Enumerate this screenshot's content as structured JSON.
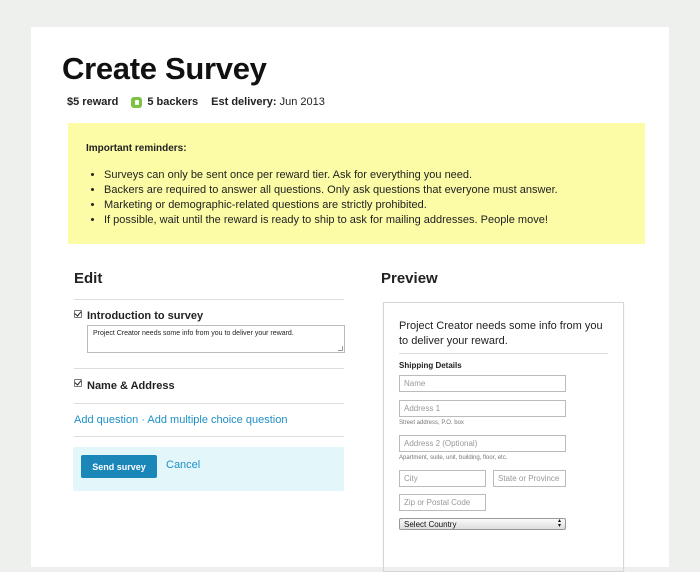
{
  "page": {
    "title": "Create Survey",
    "reward": "$5 reward",
    "backers": "5 backers",
    "delivery_label": "Est delivery:",
    "delivery_value": "Jun 2013"
  },
  "reminders": {
    "heading": "Important reminders:",
    "items": [
      "Surveys can only be sent once per reward tier. Ask for everything you need.",
      "Backers are required to answer all questions. Only ask questions that everyone must answer.",
      "Marketing or demographic-related questions are strictly prohibited.",
      "If possible, wait until the reward is ready to ship to ask for mailing addresses. People move!"
    ]
  },
  "edit": {
    "heading": "Edit",
    "intro_label": "Introduction to survey",
    "intro_text": "Project Creator needs some info from you to deliver your reward.",
    "name_address_label": "Name & Address",
    "add_question": "Add question",
    "separator": "·",
    "add_multiple_choice": "Add multiple choice question",
    "send_label": "Send survey",
    "cancel_label": "Cancel"
  },
  "preview": {
    "heading": "Preview",
    "intro_text": "Project Creator needs some info from you to deliver your reward.",
    "shipping_heading": "Shipping Details",
    "name_placeholder": "Name",
    "address1_placeholder": "Address 1",
    "address1_hint": "Street address, P.O. box",
    "address2_placeholder": "Address 2 (Optional)",
    "address2_hint": "Apartment, suite, unit, building, floor, etc.",
    "city_placeholder": "City",
    "state_placeholder": "State or Province",
    "zip_placeholder": "Zip or Postal Code",
    "country_selected": "Select Country"
  },
  "colors": {
    "accent": "#1b87b9",
    "link": "#1f8fc7",
    "reminder_bg": "#fbfca5",
    "send_area_bg": "#e3f7fb",
    "backer_icon": "#7dc242"
  }
}
